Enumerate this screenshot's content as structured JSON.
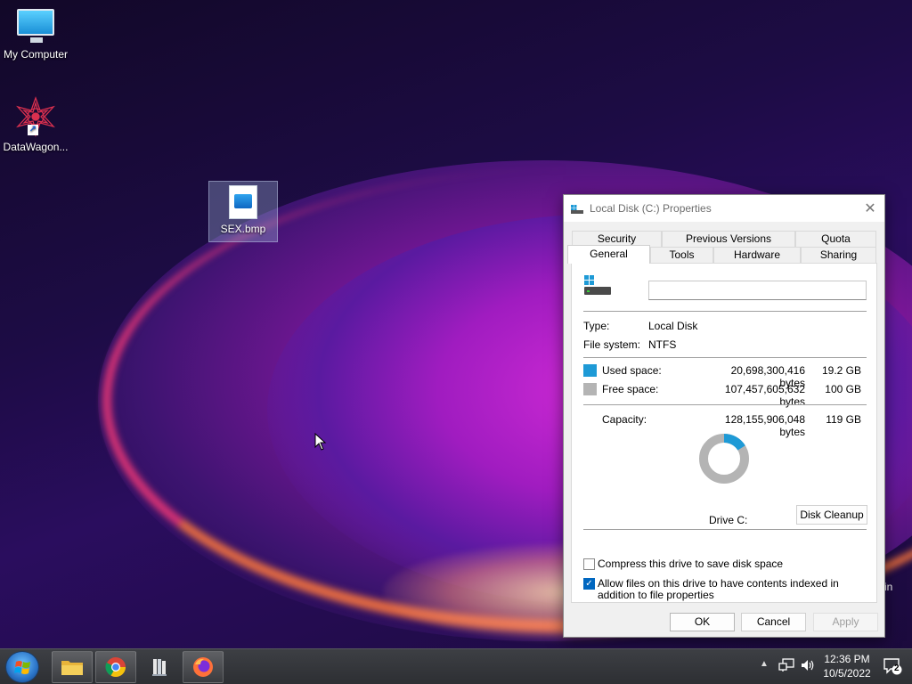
{
  "desktop": {
    "icons": [
      {
        "label": "My Computer"
      },
      {
        "label": "DataWagon..."
      },
      {
        "label": "SEX.bmp"
      }
    ],
    "wallpaper_fragment_text": "in"
  },
  "window": {
    "title": "Local Disk (C:) Properties",
    "tabs": {
      "security": "Security",
      "previous_versions": "Previous Versions",
      "quota": "Quota",
      "general": "General",
      "tools": "Tools",
      "hardware": "Hardware",
      "sharing": "Sharing"
    },
    "selected_tab": "General",
    "volume_label_value": "",
    "type_label": "Type:",
    "type_value": "Local Disk",
    "fs_label": "File system:",
    "fs_value": "NTFS",
    "used": {
      "label": "Used space:",
      "bytes": "20,698,300,416 bytes",
      "gb": "19.2 GB",
      "color": "#1e9ad6"
    },
    "free": {
      "label": "Free space:",
      "bytes": "107,457,605,632 bytes",
      "gb": "100 GB",
      "color": "#b4b4b4"
    },
    "capacity": {
      "label": "Capacity:",
      "bytes": "128,155,906,048 bytes",
      "gb": "119 GB"
    },
    "used_fraction": 0.1615,
    "drive_caption": "Drive C:",
    "disk_cleanup_label": "Disk Cleanup",
    "compress": {
      "label": "Compress this drive to save disk space",
      "checked": false
    },
    "index": {
      "label": "Allow files on this drive to have contents indexed in addition to file properties",
      "checked": true
    },
    "buttons": {
      "ok": "OK",
      "cancel": "Cancel",
      "apply": "Apply"
    }
  },
  "taskbar": {
    "pinned": [
      {
        "icon": "folder-icon"
      },
      {
        "icon": "chrome-icon"
      },
      {
        "icon": "book-icon"
      },
      {
        "icon": "firefox-icon"
      }
    ],
    "tray": {
      "time": "12:36 PM",
      "date": "10/5/2022",
      "notification_count": "2"
    }
  },
  "colors": {
    "accent": "#0067c0",
    "used": "#1e9ad6",
    "free": "#b4b4b4"
  }
}
